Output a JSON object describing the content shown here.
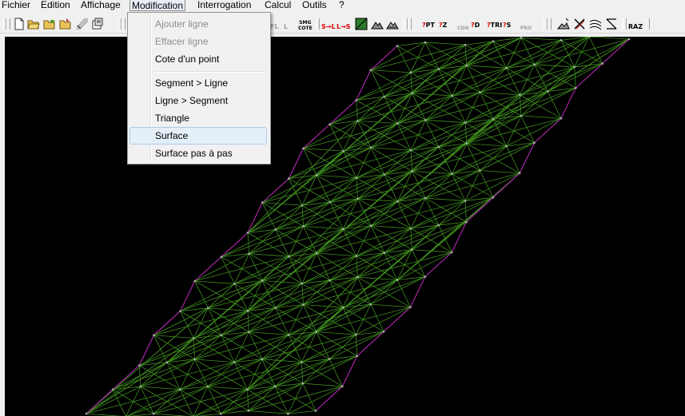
{
  "menubar": {
    "items": [
      "Fichier",
      "Edition",
      "Affichage",
      "Modification",
      "Interrogation",
      "Calcul",
      "Outils",
      "?"
    ]
  },
  "dropdown": {
    "items": [
      {
        "label": "Ajouter ligne",
        "enabled": false
      },
      {
        "label": "Effacer ligne",
        "enabled": false
      },
      {
        "label": "Cote d'un point",
        "enabled": true
      },
      {
        "label": "Segment > Ligne",
        "enabled": true
      },
      {
        "label": "Ligne > Segment",
        "enabled": true
      },
      {
        "label": "Triangle",
        "enabled": true
      },
      {
        "label": "Surface",
        "enabled": true,
        "highlighted": true
      },
      {
        "label": "Surface pas à pas",
        "enabled": true
      }
    ]
  },
  "toolbar": {
    "icons": [
      "new-file-icon",
      "open-folder-icon",
      "open-folder-icon",
      "open-folder-icon",
      "grid-icon",
      "properties-icon"
    ],
    "text_buttons": {
      "fl": "FL",
      "l": "L",
      "smg": "SMG",
      "cote": "COTE",
      "s_to_l": "S→L",
      "l_to_s": "L→S",
      "pt": "PT",
      "z": "Z",
      "cdn": "CDN",
      "d": "D",
      "tri": "TRI",
      "s": "S",
      "pro": "PRO",
      "raz": "RAZ",
      "query_mark": "?"
    }
  },
  "colors": {
    "background": "#000000",
    "mesh": "#3f8f1e",
    "boundary": "#c020c0",
    "vertex": "#b0b0b0",
    "menu_highlight": "#e4eff8"
  }
}
